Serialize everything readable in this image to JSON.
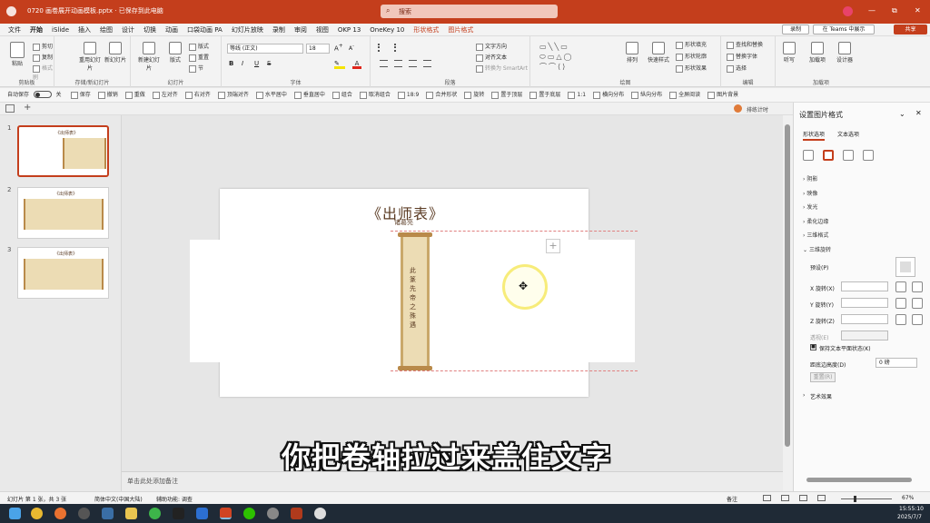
{
  "titlebar": {
    "filename": "0720 画卷展开动画模板.pptx · 已保存到此电脑",
    "search_placeholder": "搜索",
    "avatar_letter": "●",
    "minimize": "—",
    "restore": "⧉",
    "close": "✕"
  },
  "menu": {
    "items": [
      "文件",
      "开始",
      "iSlide",
      "插入",
      "绘图",
      "设计",
      "切换",
      "动画",
      "口袋动画 PA",
      "幻灯片放映",
      "录制",
      "审阅",
      "视图",
      "OKP 13",
      "OneKey 10",
      "形状格式",
      "图片格式"
    ],
    "active_index": 1,
    "record_btn": "录制",
    "teams_btn": "在 Teams 中展示",
    "share_btn": "共享"
  },
  "ribbon": {
    "clipboard": {
      "paste": "粘贴",
      "cut": "剪切",
      "copy": "复制",
      "format_painter": "格式刷",
      "label": "剪贴板"
    },
    "new_slides": {
      "btn1": "重用幻灯片",
      "btn2": "新幻灯片",
      "label": "存储/新幻灯片"
    },
    "slides": {
      "new": "新建幻灯片",
      "reuse": "版式",
      "layout": "版式",
      "reset": "重置",
      "section": "节",
      "label": "幻灯片"
    },
    "font": {
      "name": "等线 (正文)",
      "size": "18",
      "label": "字体",
      "b": "B",
      "i": "I",
      "u": "U",
      "s": "S"
    },
    "paragraph": {
      "text_dir": "文字方向",
      "align_text": "对齐文本",
      "smartart": "转换为 SmartArt",
      "label": "段落"
    },
    "drawing": {
      "arrange": "排列",
      "quick_styles": "快速样式",
      "fill": "形状填充",
      "outline": "形状轮廓",
      "effects": "形状效果",
      "label": "绘图"
    },
    "editing": {
      "find": "查找和替换",
      "replace": "替换字体",
      "select": "选择",
      "label": "编辑"
    },
    "addins": {
      "voice": "听写",
      "designer": "设计器",
      "label": "加载项",
      "b1": "听写",
      "b2": "加载项",
      "b3": "设计器"
    }
  },
  "qat": {
    "autosave_label": "自动保存",
    "autosave_state": "关",
    "items": [
      "保存",
      "撤销",
      "重做",
      "左对齐",
      "右对齐",
      "顶端对齐",
      "水平居中",
      "垂直居中",
      "组合",
      "取消组合",
      "18:9",
      "合并形状",
      "旋转",
      "置于顶层",
      "置于底层",
      "1:1",
      "横向分布",
      "纵向分布",
      "全屏阅读",
      "图片背景"
    ]
  },
  "tabstrip": {
    "add": "+",
    "right_label": "排练计时"
  },
  "thumbnails": [
    {
      "num": "1",
      "title": "《出师表》"
    },
    {
      "num": "2",
      "title": "《出师表》"
    },
    {
      "num": "3",
      "title": "《出师表》"
    }
  ],
  "slide": {
    "title": "《出师表》",
    "author": "诸葛亮",
    "scroll_text": "此 篆 先 帝 之 殊 遇",
    "move_cursor": "✥",
    "plus": "+"
  },
  "subtitle": "你把卷轴拉过来盖住文字",
  "notes": {
    "placeholder": "单击此处添加备注"
  },
  "format_pane": {
    "title": "设置图片格式",
    "tab_shape": "形状选项",
    "tab_text": "文本选项",
    "sections": [
      "阴影",
      "映像",
      "发光",
      "柔化边缘",
      "三维格式",
      "三维旋转"
    ],
    "preset_label": "预设(P)",
    "x_label": "X 旋转(X)",
    "y_label": "Y 旋转(Y)",
    "z_label": "Z 旋转(Z)",
    "persp_label": "透视(E)",
    "keep_text_flat": "保持文本平面状态(K)",
    "distance_label": "距底边高度(D)",
    "distance_value": "0 磅",
    "reset_btn": "重置(R)",
    "art_effects": "艺术效果"
  },
  "status": {
    "slide_info": "幻灯片 第 1 张，共 3 张",
    "language": "简体中文(中国大陆)",
    "accessibility": "辅助功能: 调查",
    "notes_btn": "备注",
    "zoom": "67%"
  },
  "taskbar": {
    "time": "15:55:10",
    "date": "2025/7/7"
  },
  "colors": {
    "accent": "#c43e1c",
    "scroll_paper": "#ecdcb4",
    "scroll_rod": "#b98a4a",
    "title_text": "#5a3a22"
  }
}
